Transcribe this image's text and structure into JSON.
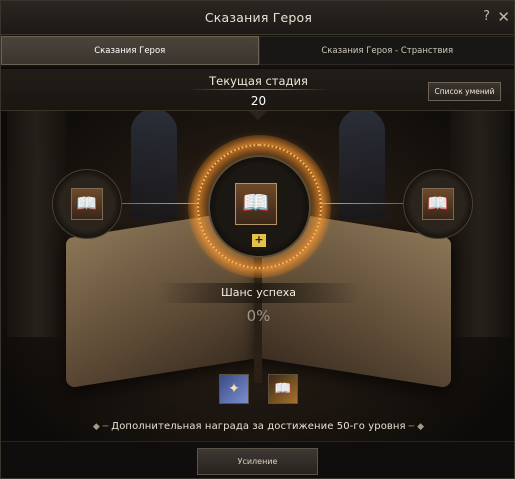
{
  "window": {
    "title": "Сказания Героя",
    "help_icon": "question-mark-icon",
    "close_icon": "close-icon"
  },
  "tabs": [
    {
      "label": "Сказания Героя",
      "active": true
    },
    {
      "label": "Сказания Героя - Странствия",
      "active": false
    }
  ],
  "stage": {
    "label": "Текущая стадия",
    "value": "20"
  },
  "skills_button": {
    "label": "Список умений"
  },
  "nodes": {
    "left_icon": "book-icon",
    "center_icon": "book-icon",
    "right_icon": "book-icon",
    "plus_label": "+"
  },
  "success": {
    "label": "Шанс успеха",
    "value": "0%"
  },
  "rewards": [
    {
      "icon": "reward-map-icon"
    },
    {
      "icon": "reward-book-icon"
    }
  ],
  "bonus_text": "Дополнительная награда за достижение 50-го уровня",
  "enhance_button": {
    "label": "Усиление"
  },
  "colors": {
    "accent_glow": "#f4b35e",
    "plus_button": "#e4c24a",
    "background": "#141210"
  }
}
